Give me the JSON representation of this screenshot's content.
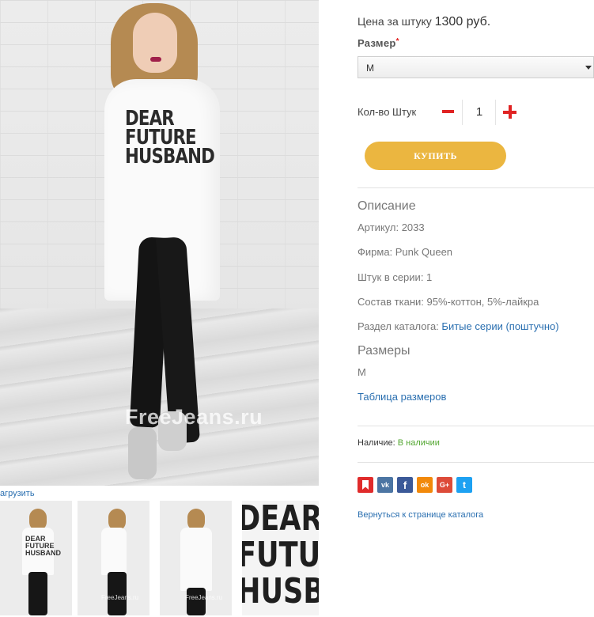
{
  "gallery": {
    "watermark": "FreeJeans.ru",
    "main_shirt_text": [
      "DEAR",
      "FUTURE",
      "HUSBAND"
    ],
    "upload_label": "агрузить",
    "thumb_watermark": "FreeJeans.ru",
    "zoom_text": [
      "DEAR",
      "FUTURE",
      "HUSBAND"
    ]
  },
  "product": {
    "price_label": "Цена за штуку",
    "price_value": "1300 руб.",
    "size_label": "Размер",
    "size_required_mark": "*",
    "size_selected": "M",
    "qty_label": "Кол-во Штук",
    "qty_value": "1",
    "buy_label": "КУПИТЬ",
    "buy_color": "#ebb640"
  },
  "description": {
    "title": "Описание",
    "article": "Артикул: 2033",
    "brand": "Фирма: Punk Queen",
    "pieces": "Штук в серии: 1",
    "fabric": "Состав ткани: 95%-коттон, 5%-лайкра",
    "catalog_label": "Раздел каталога:",
    "catalog_link": "Битые серии (поштучно)"
  },
  "sizes": {
    "title": "Размеры",
    "value": "M",
    "table_link": "Таблица размеров"
  },
  "availability": {
    "label": "Наличие:",
    "status": "В наличии",
    "status_color": "#52a630"
  },
  "share_buttons": [
    {
      "name": "bookmark-icon",
      "color": "#e02b2b"
    },
    {
      "name": "vk-icon",
      "color": "#4c75a3",
      "text": "vk"
    },
    {
      "name": "facebook-icon",
      "color": "#3b5998",
      "text": "f"
    },
    {
      "name": "odnoklassniki-icon",
      "color": "#f2890a",
      "text": "ok"
    },
    {
      "name": "google-plus-icon",
      "color": "#dd4b39",
      "text": "G+"
    },
    {
      "name": "twitter-icon",
      "color": "#1da1f2",
      "text": "t"
    }
  ],
  "back_link": "Вернуться к странице каталога",
  "accent_link_color": "#2a6fb0"
}
